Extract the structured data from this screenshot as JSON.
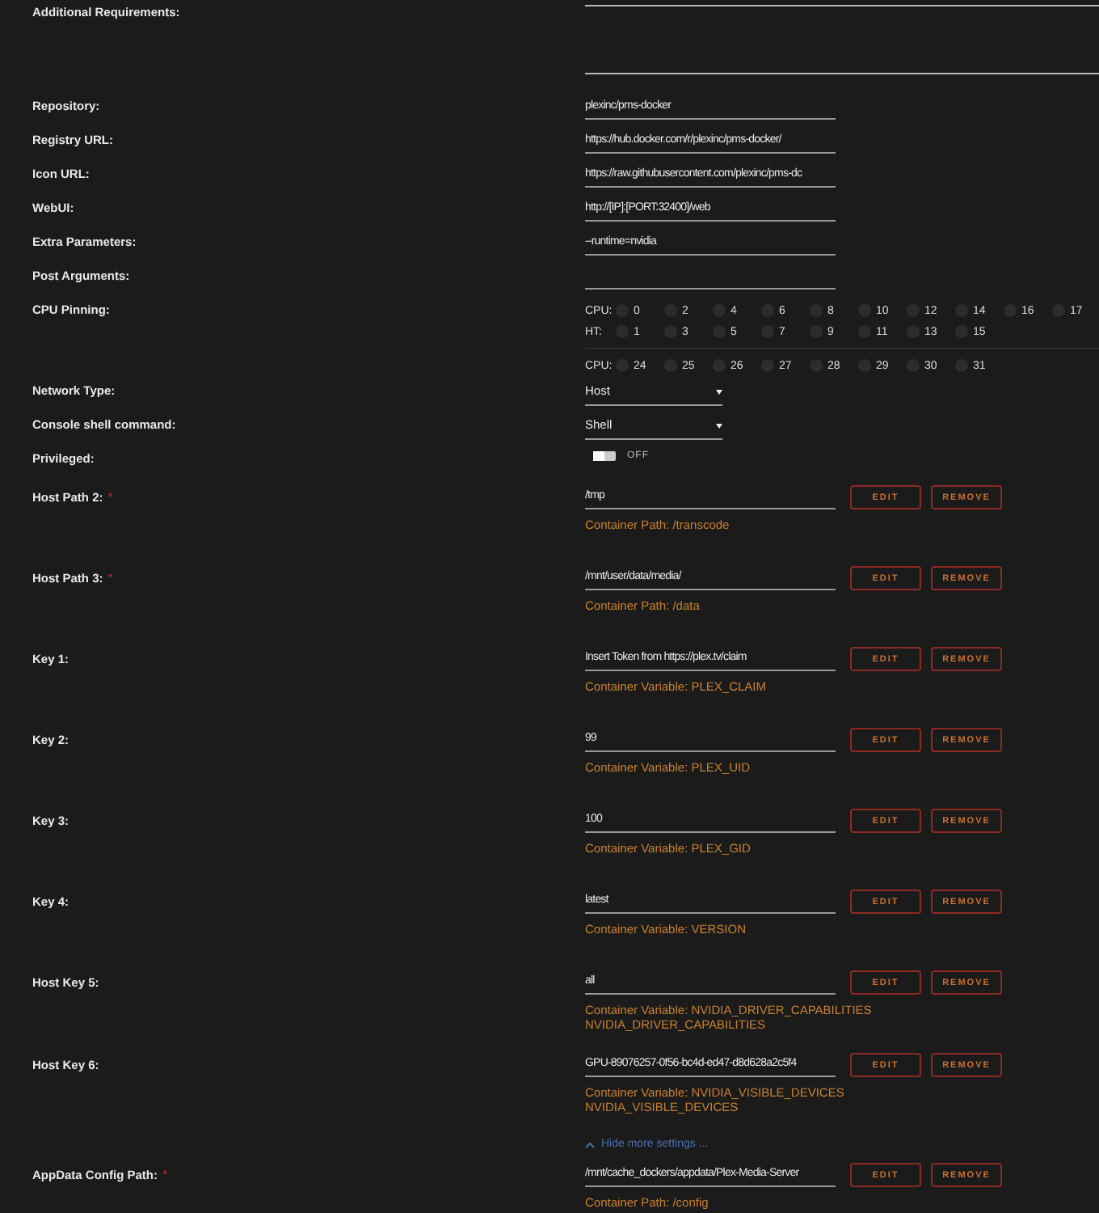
{
  "settings": [
    {
      "kind": "textarea",
      "label": "Additional Requirements:"
    },
    {
      "kind": "text",
      "label": "Repository:",
      "value": "plexinc/pms-docker"
    },
    {
      "kind": "text",
      "label": "Registry URL:",
      "value": "https://hub.docker.com/r/plexinc/pms-docker/"
    },
    {
      "kind": "text",
      "label": "Icon URL:",
      "value": "https://raw.githubusercontent.com/plexinc/pms-dc"
    },
    {
      "kind": "text",
      "label": "WebUI:",
      "value": "http://[IP]:[PORT:32400]/web"
    },
    {
      "kind": "text",
      "label": "Extra Parameters:",
      "value": "--runtime=nvidia"
    },
    {
      "kind": "text",
      "label": "Post Arguments:"
    },
    {
      "kind": "cpu",
      "label": "CPU Pinning:",
      "groups": [
        {
          "rows": [
            {
              "label": "CPU:",
              "cores": [
                {
                  "number": "0",
                  "checked": false
                },
                {
                  "number": "2",
                  "checked": false
                },
                {
                  "number": "4",
                  "checked": false
                },
                {
                  "number": "6",
                  "checked": false
                },
                {
                  "number": "8",
                  "checked": false
                },
                {
                  "number": "10",
                  "checked": false
                },
                {
                  "number": "12",
                  "checked": false
                },
                {
                  "number": "14",
                  "checked": false
                },
                {
                  "number": "16",
                  "checked": false
                },
                {
                  "number": "17",
                  "checked": false
                }
              ]
            },
            {
              "label": "HT:",
              "cores": [
                {
                  "number": "1",
                  "checked": false
                },
                {
                  "number": "3",
                  "checked": false
                },
                {
                  "number": "5",
                  "checked": false
                },
                {
                  "number": "7",
                  "checked": false
                },
                {
                  "number": "9",
                  "checked": false
                },
                {
                  "number": "11",
                  "checked": false
                },
                {
                  "number": "13",
                  "checked": false
                },
                {
                  "number": "15",
                  "checked": false
                }
              ]
            }
          ]
        },
        {
          "rows": [
            {
              "label": "CPU:",
              "cores": [
                {
                  "number": "24",
                  "checked": false
                },
                {
                  "number": "25",
                  "checked": false
                },
                {
                  "number": "26",
                  "checked": false
                },
                {
                  "number": "27",
                  "checked": false
                },
                {
                  "number": "28",
                  "checked": false
                },
                {
                  "number": "29",
                  "checked": false
                },
                {
                  "number": "30",
                  "checked": false
                },
                {
                  "number": "31",
                  "checked": false
                }
              ]
            }
          ]
        }
      ]
    },
    {
      "kind": "select",
      "label": "Network Type:",
      "value": "Host"
    },
    {
      "kind": "select",
      "label": "Console shell command:",
      "value": "Shell"
    },
    {
      "kind": "toggle",
      "label": "Privileged:",
      "on": false,
      "state_text": "OFF"
    }
  ],
  "configs": [
    {
      "kind": "config",
      "label": "Host Path 2:",
      "required_mark": "*",
      "value": "/tmp",
      "description": [
        "Container Path: /transcode"
      ],
      "buttons": [
        "EDIT",
        "REMOVE"
      ]
    },
    {
      "kind": "config",
      "label": "Host Path 3:",
      "required_mark": "*",
      "value": "/mnt/user/data/media/",
      "description": [
        "Container Path: /data"
      ],
      "buttons": [
        "EDIT",
        "REMOVE"
      ]
    },
    {
      "kind": "config",
      "label": "Key 1:",
      "value": "Insert Token from https://plex.tv/claim",
      "description": [
        "Container Variable: PLEX_CLAIM"
      ],
      "buttons": [
        "EDIT",
        "REMOVE"
      ]
    },
    {
      "kind": "config",
      "label": "Key 2:",
      "value": "99",
      "description": [
        "Container Variable: PLEX_UID"
      ],
      "buttons": [
        "EDIT",
        "REMOVE"
      ]
    },
    {
      "kind": "config",
      "label": "Key 3:",
      "value": "100",
      "description": [
        "Container Variable: PLEX_GID"
      ],
      "buttons": [
        "EDIT",
        "REMOVE"
      ]
    },
    {
      "kind": "config",
      "label": "Key 4:",
      "value": "latest",
      "description": [
        "Container Variable: VERSION"
      ],
      "buttons": [
        "EDIT",
        "REMOVE"
      ]
    },
    {
      "kind": "config",
      "label": "Host Key 5:",
      "value": "all",
      "description": [
        "Container Variable: NVIDIA_DRIVER_CAPABILITIES",
        "NVIDIA_DRIVER_CAPABILITIES"
      ],
      "buttons": [
        "EDIT",
        "REMOVE"
      ]
    },
    {
      "kind": "config",
      "label": "Host Key 6:",
      "value": "GPU-89076257-0f56-bc4d-ed47-d8d628a2c5f4",
      "description": [
        "Container Variable: NVIDIA_VISIBLE_DEVICES",
        "NVIDIA_VISIBLE_DEVICES"
      ],
      "buttons": [
        "EDIT",
        "REMOVE"
      ]
    },
    {
      "kind": "link",
      "text": "Hide more settings ..."
    },
    {
      "kind": "config",
      "label": "AppData Config Path:",
      "required_mark": "*",
      "value": "/mnt/cache_dockers/appdata/Plex-Media-Server",
      "description": [
        "Container Path: /config"
      ],
      "buttons": [
        "EDIT",
        "REMOVE"
      ]
    }
  ]
}
